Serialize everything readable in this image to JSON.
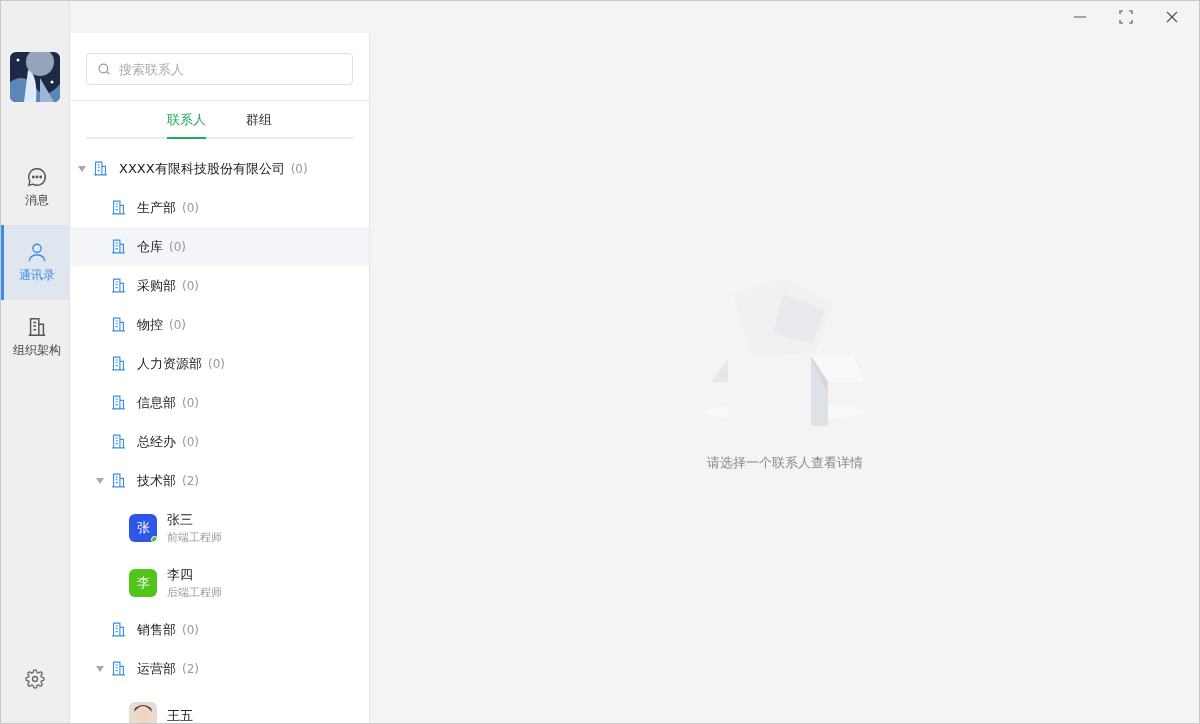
{
  "rail": {
    "items": [
      {
        "label": "消息",
        "kind": "chat",
        "selected": false
      },
      {
        "label": "通讯录",
        "kind": "user",
        "selected": true
      },
      {
        "label": "组织架构",
        "kind": "building",
        "selected": false
      }
    ]
  },
  "search": {
    "placeholder": "搜索联系人"
  },
  "tabs": [
    {
      "label": "联系人",
      "selected": true
    },
    {
      "label": "群组",
      "selected": false
    }
  ],
  "tree": [
    {
      "kind": "dept",
      "name": "XXXX有限科技股份有限公司",
      "count": "(0)",
      "selected": false,
      "expanded": true,
      "children": [
        {
          "kind": "dept",
          "name": "生产部",
          "count": "(0)",
          "selected": false
        },
        {
          "kind": "dept",
          "name": "仓库",
          "count": "(0)",
          "selected": true
        },
        {
          "kind": "dept",
          "name": "采购部",
          "count": "(0)",
          "selected": false
        },
        {
          "kind": "dept",
          "name": "物控",
          "count": "(0)",
          "selected": false
        },
        {
          "kind": "dept",
          "name": "人力资源部",
          "count": "(0)",
          "selected": false
        },
        {
          "kind": "dept",
          "name": "信息部",
          "count": "(0)",
          "selected": false
        },
        {
          "kind": "dept",
          "name": "总经办",
          "count": "(0)",
          "selected": false
        },
        {
          "kind": "dept",
          "name": "技术部",
          "count": "(2)",
          "selected": false,
          "expanded": true,
          "children": [
            {
              "kind": "contact",
              "name": "张三",
              "title": "前端工程师",
              "avatar_text": "张",
              "color": "#3056e8",
              "online": true,
              "selected": false
            },
            {
              "kind": "contact",
              "name": "李四",
              "title": "后端工程师",
              "avatar_text": "李",
              "color": "#52c41a",
              "online": false,
              "selected": false
            }
          ]
        },
        {
          "kind": "dept",
          "name": "销售部",
          "count": "(0)",
          "selected": false
        },
        {
          "kind": "dept",
          "name": "运营部",
          "count": "(2)",
          "selected": false,
          "expanded": true,
          "children": [
            {
              "kind": "contact",
              "name": "王五",
              "selected": false
            }
          ]
        }
      ]
    }
  ],
  "empty": {
    "message": "请选择一个联系人查看详情"
  }
}
